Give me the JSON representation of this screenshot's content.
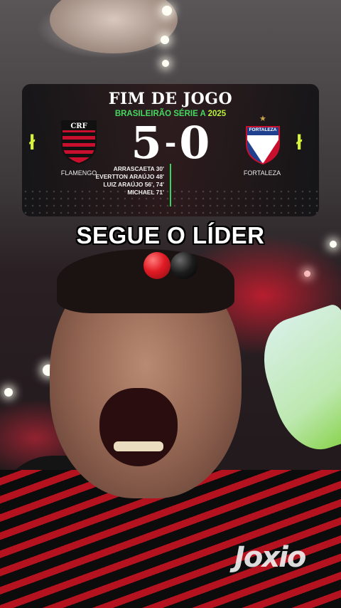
{
  "card": {
    "title": "FIM DE JOGO",
    "competition": "BRASILEIRÃO SÉRIE A",
    "year": "2025",
    "home_team": "FLAMENGO",
    "away_team": "FORTALEZA",
    "home_score": "5",
    "away_score": "0",
    "separator": "-",
    "away_crest_text": "FORTALEZA",
    "scorers": [
      "ARRASCAETA 30'",
      "EVERTTON ARAÚJO 48'",
      "LUIZ ARAÚJO 56', 74'",
      "MICHAEL 71'"
    ],
    "colors": {
      "competition_green": "#45d860",
      "year_lime": "#b7f23a",
      "accent_lime": "#d8f53a",
      "flamengo_red": "#c8102e",
      "fortaleza_blue": "#1f3f8f"
    }
  },
  "caption": {
    "headline": "SEGUE O LÍDER",
    "emoji": [
      "red-circle",
      "black-circle"
    ]
  },
  "photo": {
    "sponsor_text": "Joxio"
  }
}
